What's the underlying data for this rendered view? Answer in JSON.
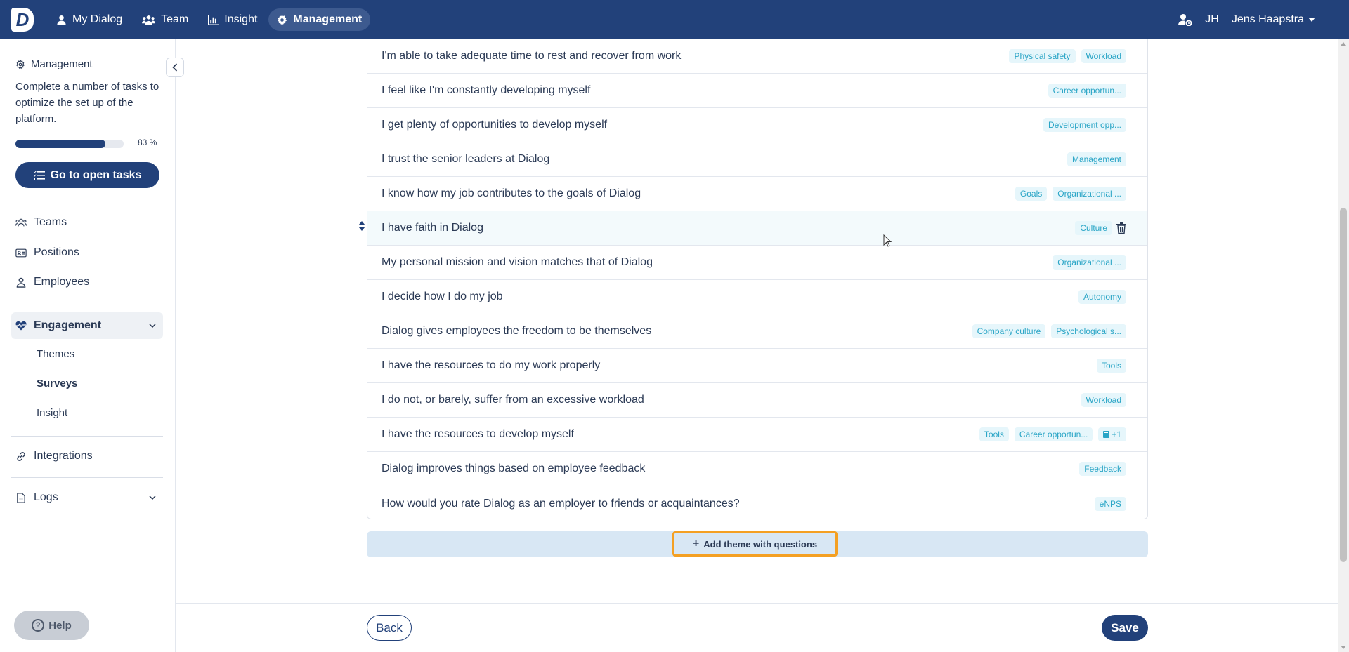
{
  "nav": {
    "logo": "D",
    "items": [
      {
        "label": "My Dialog",
        "icon": "user-icon"
      },
      {
        "label": "Team",
        "icon": "users-icon"
      },
      {
        "label": "Insight",
        "icon": "chart-icon"
      },
      {
        "label": "Management",
        "icon": "gear-icon",
        "active": true
      }
    ],
    "initials": "JH",
    "user_name": "Jens Haapstra"
  },
  "sidebar": {
    "heading": "Management",
    "description": "Complete a number of tasks to optimize the set up of the platform.",
    "progress_percent": 83,
    "progress_label": "83 %",
    "go_button": "Go to open tasks",
    "items": {
      "teams": "Teams",
      "positions": "Positions",
      "employees": "Employees",
      "engagement": "Engagement",
      "themes": "Themes",
      "surveys": "Surveys",
      "insight": "Insight",
      "integrations": "Integrations",
      "logs": "Logs"
    },
    "help": "Help"
  },
  "questions": [
    {
      "text": "I'm able to take adequate time to rest and recover from work",
      "tags": [
        "Physical safety",
        "Workload"
      ]
    },
    {
      "text": "I feel like I'm constantly developing myself",
      "tags": [
        "Career opportun..."
      ]
    },
    {
      "text": "I get plenty of opportunities to develop myself",
      "tags": [
        "Development opp..."
      ]
    },
    {
      "text": "I trust the senior leaders at Dialog",
      "tags": [
        "Management"
      ]
    },
    {
      "text": "I know how my job contributes to the goals of Dialog",
      "tags": [
        "Goals",
        "Organizational ..."
      ]
    },
    {
      "text": "I have faith in Dialog",
      "tags": [
        "Culture"
      ],
      "hovered": true
    },
    {
      "text": "My personal mission and vision matches that of Dialog",
      "tags": [
        "Organizational ..."
      ]
    },
    {
      "text": "I decide how I do my job",
      "tags": [
        "Autonomy"
      ]
    },
    {
      "text": "Dialog gives employees the freedom to be themselves",
      "tags": [
        "Company culture",
        "Psychological s..."
      ]
    },
    {
      "text": "I have the resources to do my work properly",
      "tags": [
        "Tools"
      ]
    },
    {
      "text": "I do not, or barely, suffer from an excessive workload",
      "tags": [
        "Workload"
      ]
    },
    {
      "text": "I have the resources to develop myself",
      "tags": [
        "Tools",
        "Career opportun...",
        "+1"
      ]
    },
    {
      "text": "Dialog improves things based on employee feedback",
      "tags": [
        "Feedback"
      ]
    },
    {
      "text": "How would you rate Dialog as an employer to friends or acquaintances?",
      "tags": [
        "eNPS"
      ]
    }
  ],
  "actions": {
    "add_theme": "Add theme with questions",
    "back": "Back",
    "save": "Save"
  },
  "colors": {
    "primary": "#22417a",
    "tag_bg": "#e6f6fb",
    "tag_text": "#2aa5c6",
    "highlight": "#f4a023"
  }
}
